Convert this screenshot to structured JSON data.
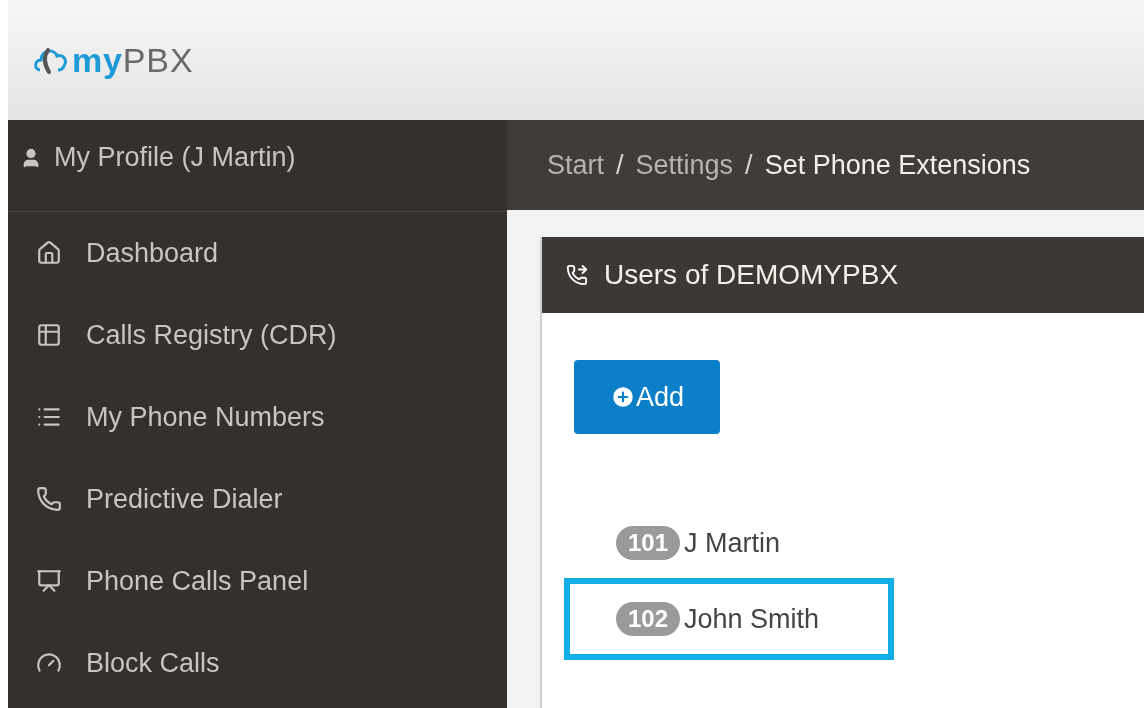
{
  "header": {
    "logo_prefix": "my",
    "logo_suffix": "PBX"
  },
  "sidebar": {
    "profile": "My Profile (J Martin)",
    "items": [
      {
        "kind": "home",
        "label": "Dashboard"
      },
      {
        "kind": "registry",
        "label": "Calls Registry (CDR)"
      },
      {
        "kind": "numbers",
        "label": "My Phone Numbers"
      },
      {
        "kind": "phone",
        "label": "Predictive Dialer"
      },
      {
        "kind": "panel",
        "label": "Phone Calls Panel"
      },
      {
        "kind": "block",
        "label": "Block Calls"
      }
    ]
  },
  "breadcrumb": [
    {
      "label": "Start",
      "current": false
    },
    {
      "label": "Settings",
      "current": false
    },
    {
      "label": "Set Phone Extensions",
      "current": true
    }
  ],
  "breadcrumb_separator": "/",
  "panel": {
    "title": "Users of DEMOMYPBX",
    "add_button": "Add",
    "users": [
      {
        "extension": "101",
        "name": "J Martin",
        "highlighted": false
      },
      {
        "extension": "102",
        "name": "John Smith",
        "highlighted": true
      }
    ]
  }
}
